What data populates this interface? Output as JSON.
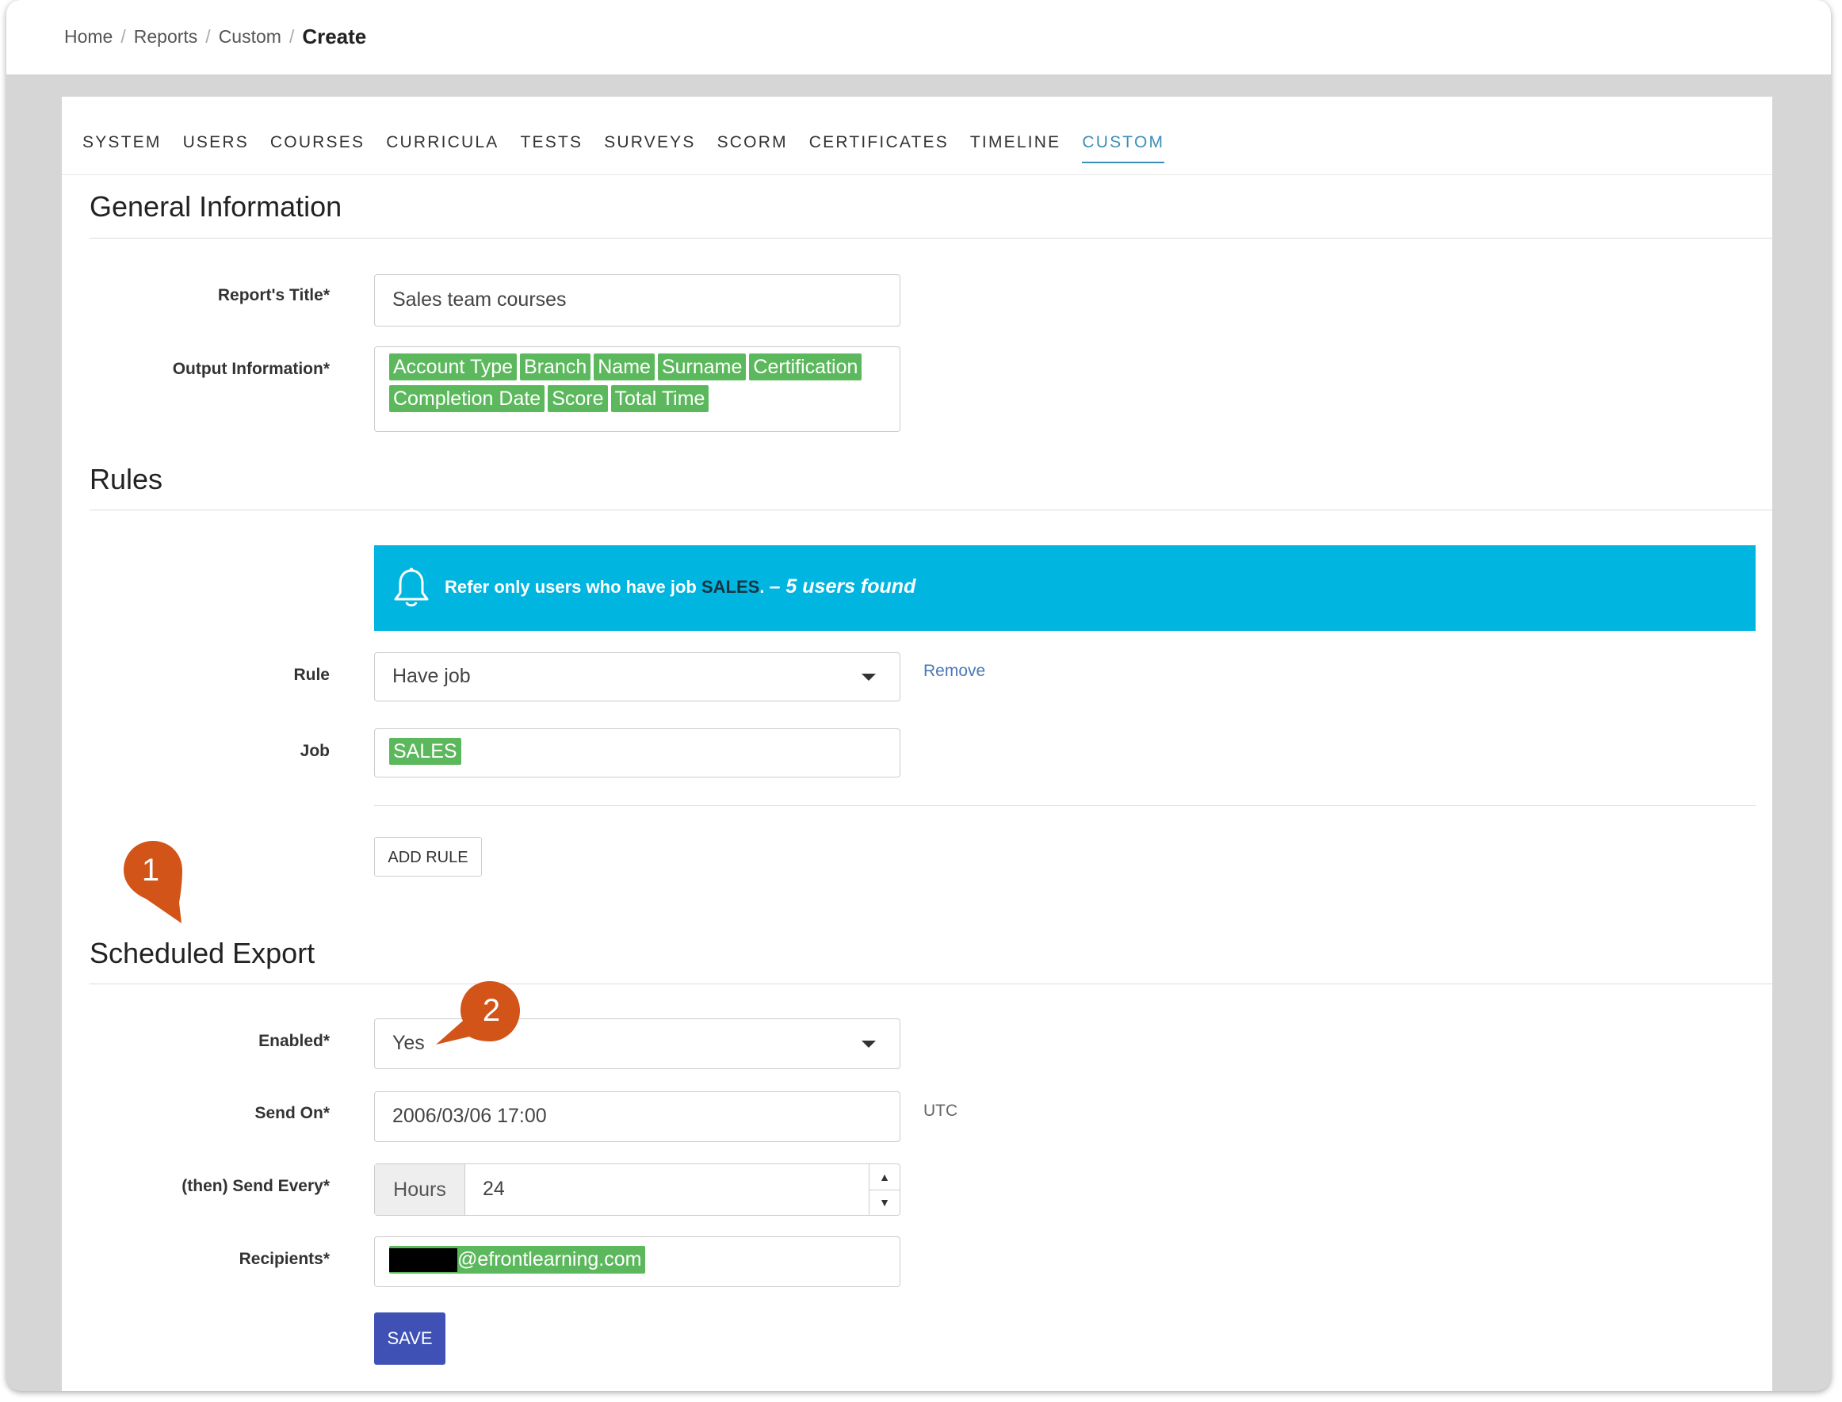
{
  "breadcrumb": {
    "items": [
      "Home",
      "Reports",
      "Custom"
    ],
    "current": "Create"
  },
  "tabs": [
    "SYSTEM",
    "USERS",
    "COURSES",
    "CURRICULA",
    "TESTS",
    "SURVEYS",
    "SCORM",
    "CERTIFICATES",
    "TIMELINE",
    "CUSTOM"
  ],
  "active_tab": "CUSTOM",
  "general": {
    "title": "General Information",
    "report_title_label": "Report's Title*",
    "report_title_value": "Sales team courses",
    "output_label": "Output Information*",
    "output_tags": [
      "Account Type",
      "Branch",
      "Name",
      "Surname",
      "Certification",
      "Completion Date",
      "Score",
      "Total Time"
    ]
  },
  "rules": {
    "title": "Rules",
    "alert_prefix": "Refer only users who have job ",
    "alert_job": "SALES",
    "alert_suffix": ". ",
    "alert_count": "– 5 users found",
    "rule_label": "Rule",
    "rule_value": "Have job",
    "remove_label": "Remove",
    "job_label": "Job",
    "job_tag": "SALES",
    "add_rule_label": "ADD RULE"
  },
  "export": {
    "title": "Scheduled Export",
    "enabled_label": "Enabled*",
    "enabled_value": "Yes",
    "send_on_label": "Send On*",
    "send_on_value": "2006/03/06 17:00",
    "timezone": "UTC",
    "send_every_label": "(then) Send Every*",
    "send_every_unit": "Hours",
    "send_every_value": "24",
    "recipients_label": "Recipients*",
    "recipient_email": "@efrontlearning.com",
    "save_label": "SAVE"
  },
  "markers": [
    "1",
    "2"
  ],
  "colors": {
    "tag_green": "#5cb85c",
    "alert_blue": "#00b5e0",
    "active_tab": "#3a8fb7",
    "primary_button": "#3f51b5",
    "marker_orange": "#d35418",
    "link_blue": "#4a78b5"
  }
}
